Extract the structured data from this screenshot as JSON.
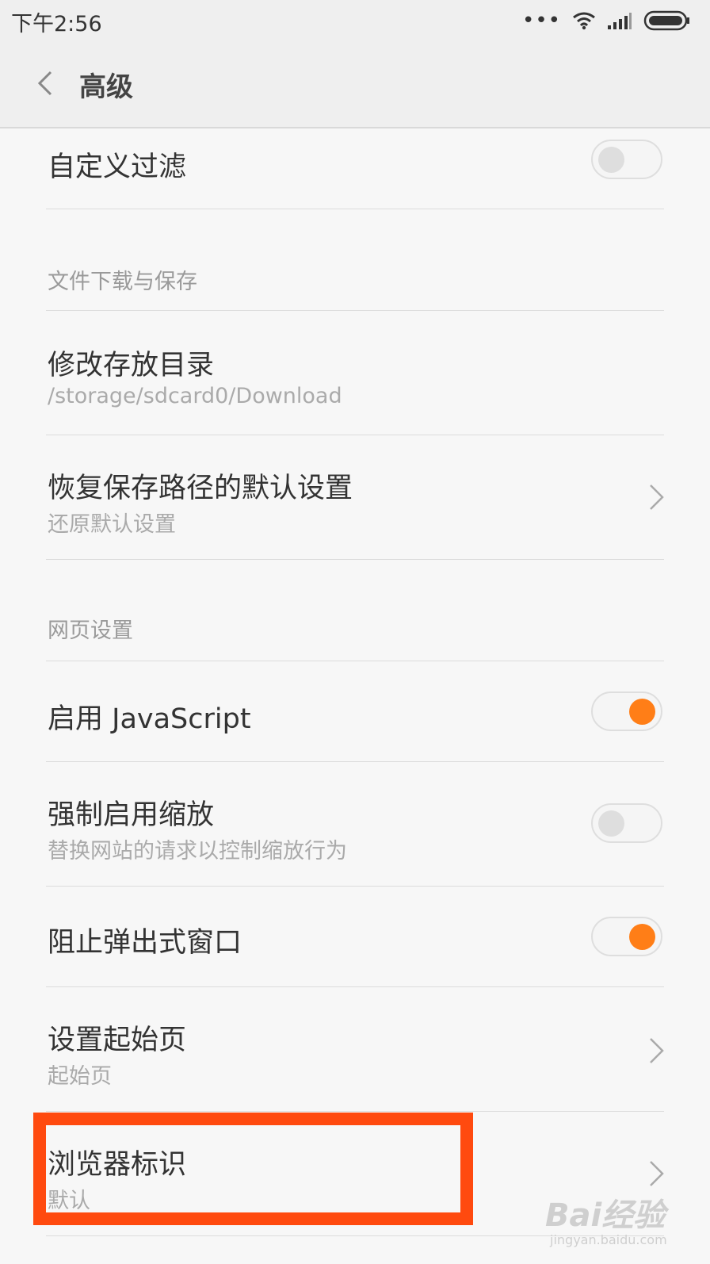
{
  "status": {
    "time": "下午2:56"
  },
  "header": {
    "title": "高级"
  },
  "items": {
    "custom_filter": {
      "label": "自定义过滤",
      "enabled": false
    },
    "section_download": "文件下载与保存",
    "change_dir": {
      "label": "修改存放目录",
      "sub": "/storage/sdcard0/Download"
    },
    "restore_path": {
      "label": "恢复保存路径的默认设置",
      "sub": "还原默认设置"
    },
    "section_web": "网页设置",
    "javascript": {
      "label": "启用 JavaScript",
      "enabled": true
    },
    "force_zoom": {
      "label": "强制启用缩放",
      "sub": "替换网站的请求以控制缩放行为",
      "enabled": false
    },
    "block_popups": {
      "label": "阻止弹出式窗口",
      "enabled": true
    },
    "homepage": {
      "label": "设置起始页",
      "sub": "起始页"
    },
    "user_agent": {
      "label": "浏览器标识",
      "sub": "默认"
    }
  },
  "colors": {
    "accent": "#ff7e17",
    "highlight_box": "#ff4a0f"
  },
  "icons": [
    "back-chevron-icon",
    "wifi-icon",
    "signal-icon",
    "battery-icon",
    "chevron-right-icon"
  ],
  "watermark": {
    "logo": "Bai经验",
    "url": "jingyan.baidu.com"
  }
}
